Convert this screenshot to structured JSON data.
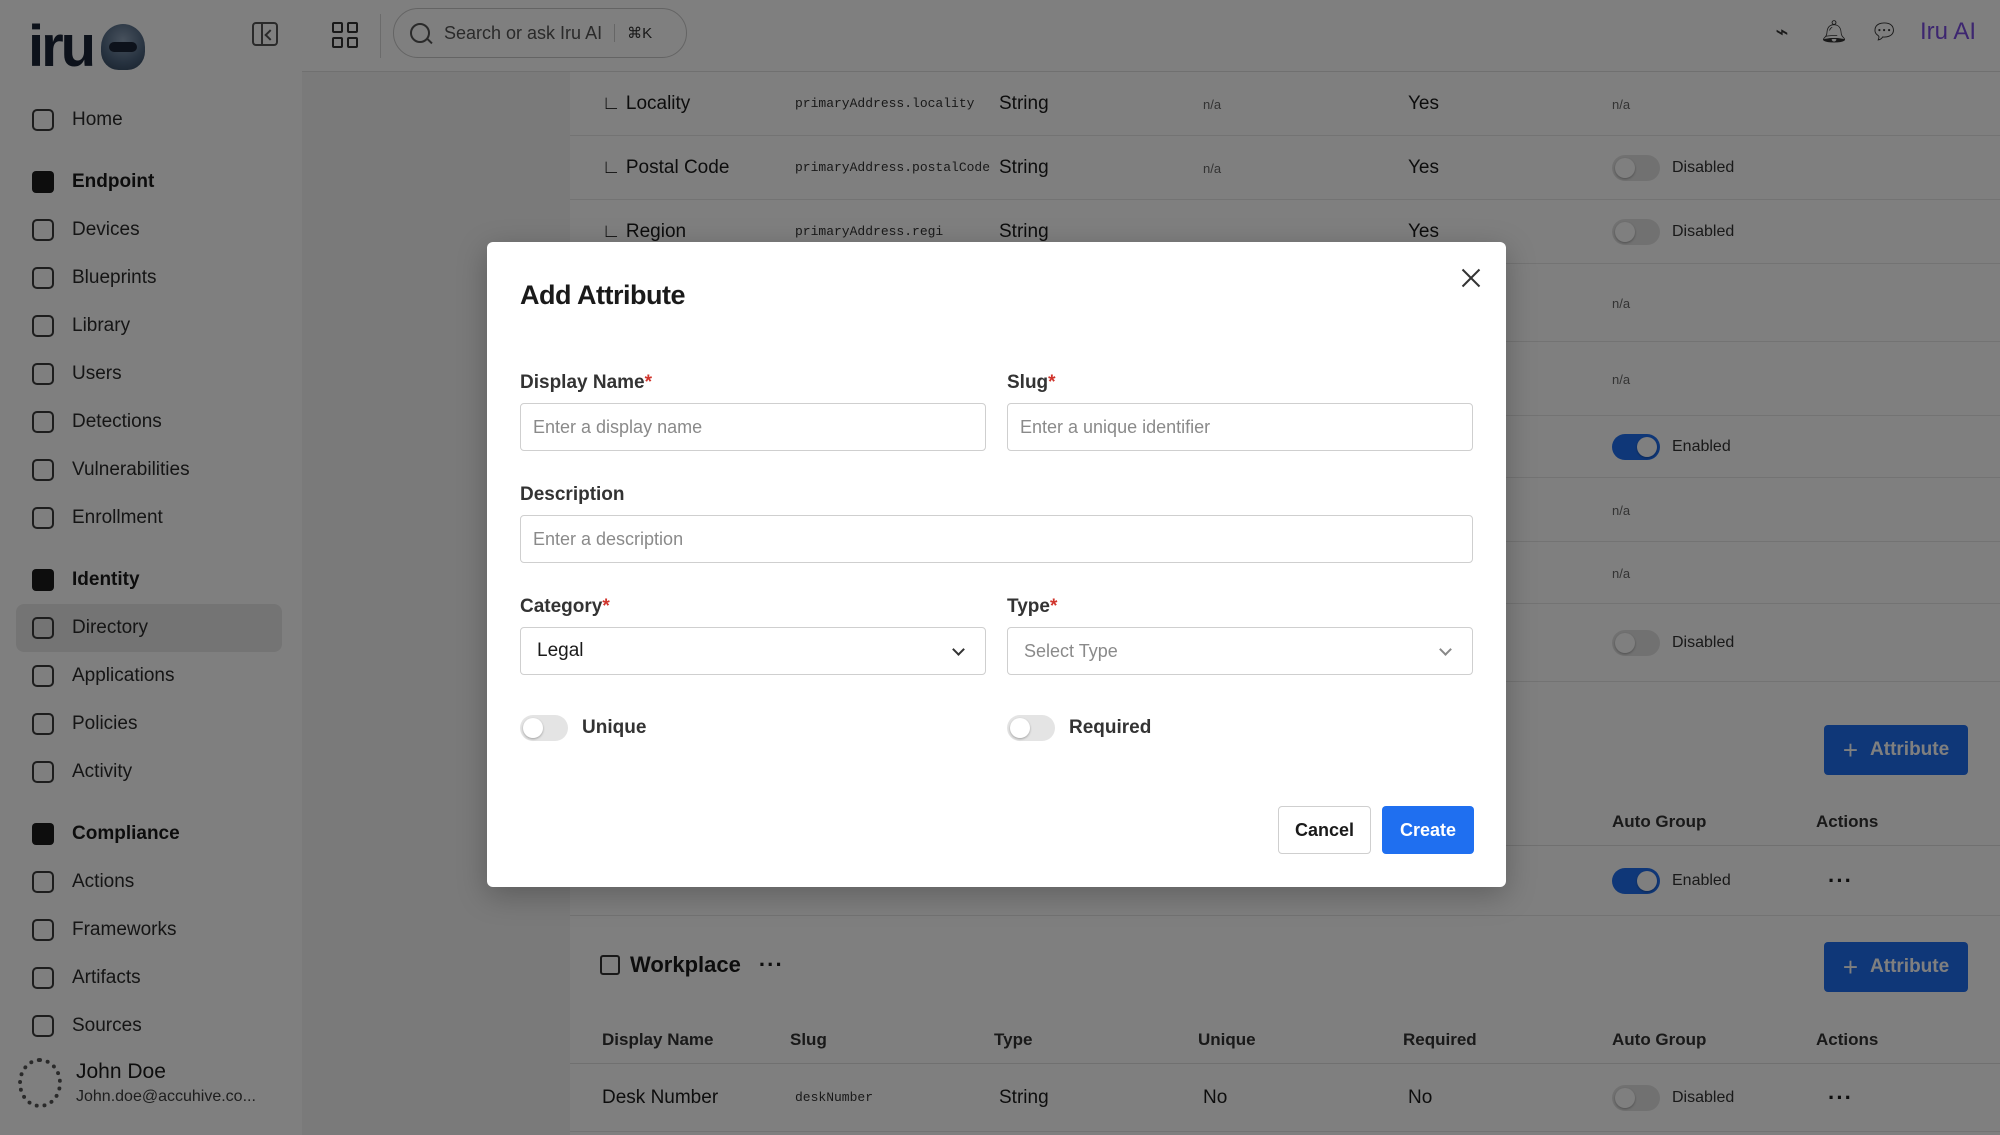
{
  "sidebar": {
    "logo_text": "iru",
    "items": {
      "home": "Home",
      "endpoint": "Endpoint",
      "devices": "Devices",
      "blueprints": "Blueprints",
      "library": "Library",
      "users": "Users",
      "detections": "Detections",
      "vulnerabilities": "Vulnerabilities",
      "enrollment": "Enrollment",
      "identity": "Identity",
      "directory": "Directory",
      "applications": "Applications",
      "policies": "Policies",
      "activity": "Activity",
      "compliance": "Compliance",
      "actions": "Actions",
      "frameworks": "Frameworks",
      "artifacts": "Artifacts",
      "sources": "Sources"
    },
    "user": {
      "name": "John Doe",
      "email": "John.doe@accuhive.co..."
    }
  },
  "topbar": {
    "search_placeholder": "Search or ask Iru AI",
    "search_shortcut": "⌘K",
    "ai_label": "Iru AI"
  },
  "table": {
    "rows": [
      {
        "name": "∟ Locality",
        "slug": "primaryAddress.locality",
        "type": "String",
        "unique": "n/a",
        "required": "Yes",
        "auto_group": "n/a"
      },
      {
        "name": "∟ Postal Code",
        "slug": "primaryAddress.postalCode",
        "type": "String",
        "unique": "n/a",
        "required": "Yes",
        "auto_group": "Disabled"
      },
      {
        "name": "∟ Region",
        "slug": "primaryAddress.regi",
        "type": "String",
        "unique": "",
        "required": "Yes",
        "auto_group": "Disabled"
      }
    ],
    "right_column": {
      "r4": "n/a",
      "r5": "n/a",
      "r6": "Enabled",
      "r7": "n/a",
      "r8": "n/a",
      "r9": "Disabled"
    },
    "attribute_button": "Attribute",
    "headers": {
      "display_name": "Display Name",
      "slug": "Slug",
      "type": "Type",
      "unique": "Unique",
      "required": "Required",
      "auto_group": "Auto Group",
      "actions": "Actions"
    },
    "legal_row_auto_group": "Enabled",
    "workplace": {
      "title": "Workplace",
      "row": {
        "name": "Desk Number",
        "slug": "deskNumber",
        "type": "String",
        "unique": "No",
        "required": "No",
        "auto_group": "Disabled"
      }
    }
  },
  "modal": {
    "title": "Add Attribute",
    "display_name": {
      "label": "Display Name",
      "placeholder": "Enter a display name"
    },
    "slug": {
      "label": "Slug",
      "placeholder": "Enter a unique identifier"
    },
    "description": {
      "label": "Description",
      "placeholder": "Enter a description"
    },
    "category": {
      "label": "Category",
      "value": "Legal"
    },
    "type": {
      "label": "Type",
      "placeholder": "Select Type"
    },
    "unique_label": "Unique",
    "required_label": "Required",
    "required_mark": "*",
    "cancel": "Cancel",
    "create": "Create"
  },
  "colors": {
    "primary": "#1f6ff0",
    "ai": "#7a4de0",
    "required": "#d0342c"
  }
}
